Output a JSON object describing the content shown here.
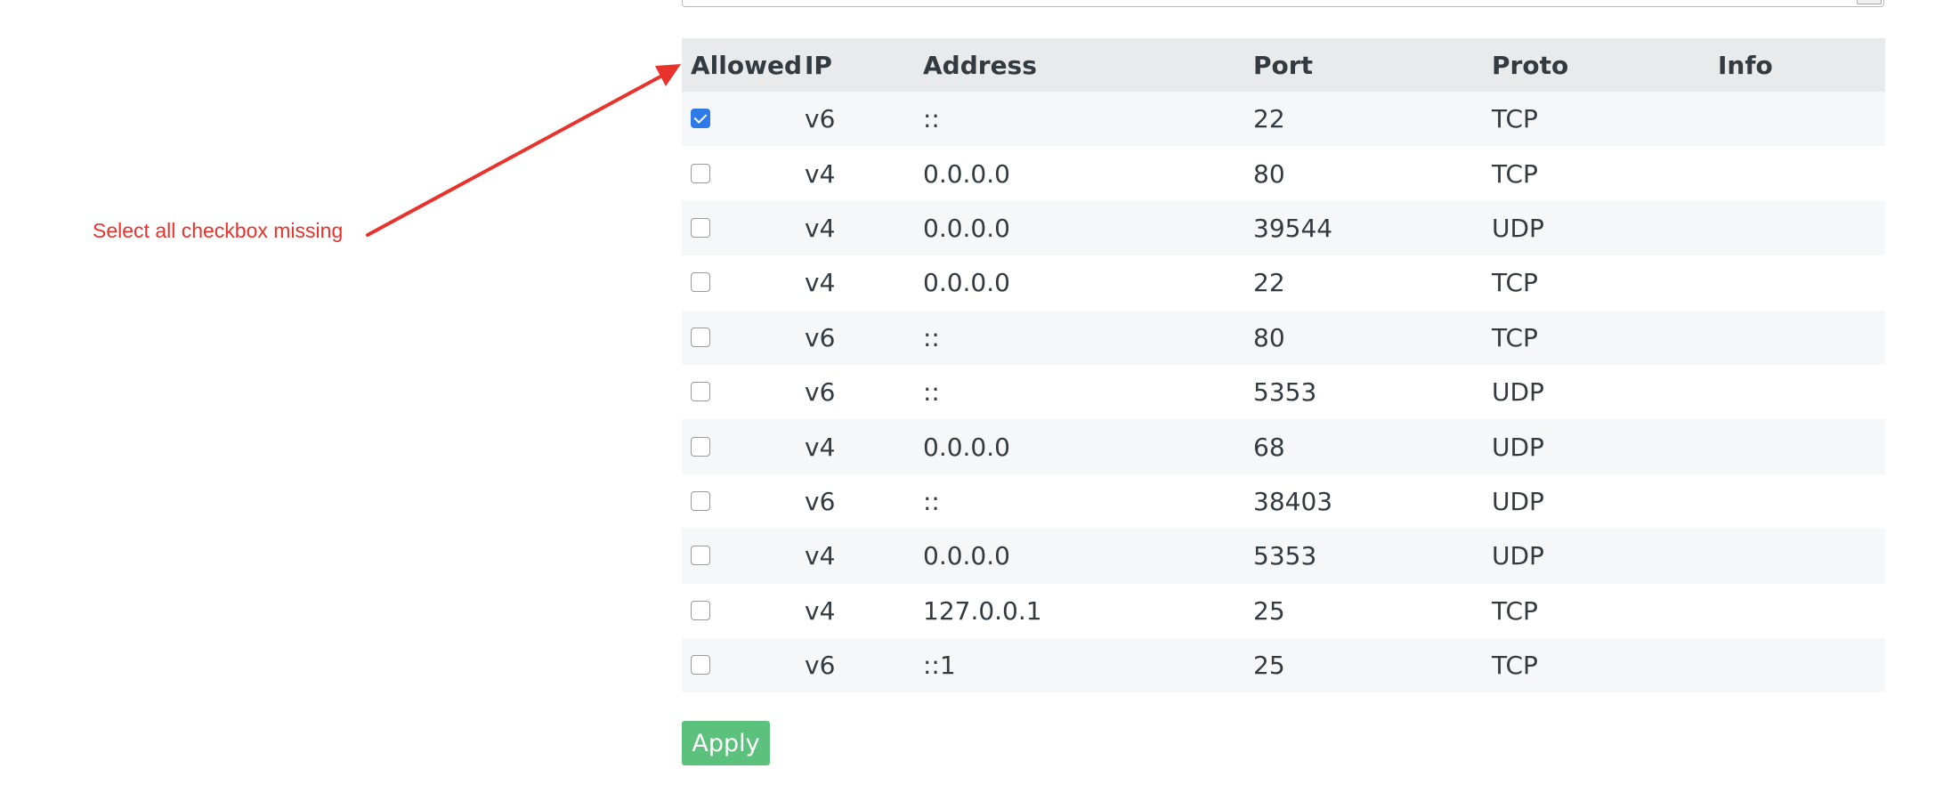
{
  "table": {
    "headers": {
      "allowed": "Allowed",
      "ip": "IP",
      "address": "Address",
      "port": "Port",
      "proto": "Proto",
      "info": "Info"
    },
    "rows": [
      {
        "allowed": true,
        "ip": "v6",
        "address": "::",
        "port": "22",
        "proto": "TCP",
        "info": ""
      },
      {
        "allowed": false,
        "ip": "v4",
        "address": "0.0.0.0",
        "port": "80",
        "proto": "TCP",
        "info": ""
      },
      {
        "allowed": false,
        "ip": "v4",
        "address": "0.0.0.0",
        "port": "39544",
        "proto": "UDP",
        "info": ""
      },
      {
        "allowed": false,
        "ip": "v4",
        "address": "0.0.0.0",
        "port": "22",
        "proto": "TCP",
        "info": ""
      },
      {
        "allowed": false,
        "ip": "v6",
        "address": "::",
        "port": "80",
        "proto": "TCP",
        "info": ""
      },
      {
        "allowed": false,
        "ip": "v6",
        "address": "::",
        "port": "5353",
        "proto": "UDP",
        "info": ""
      },
      {
        "allowed": false,
        "ip": "v4",
        "address": "0.0.0.0",
        "port": "68",
        "proto": "UDP",
        "info": ""
      },
      {
        "allowed": false,
        "ip": "v6",
        "address": "::",
        "port": "38403",
        "proto": "UDP",
        "info": ""
      },
      {
        "allowed": false,
        "ip": "v4",
        "address": "0.0.0.0",
        "port": "5353",
        "proto": "UDP",
        "info": ""
      },
      {
        "allowed": false,
        "ip": "v4",
        "address": "127.0.0.1",
        "port": "25",
        "proto": "TCP",
        "info": ""
      },
      {
        "allowed": false,
        "ip": "v6",
        "address": "::1",
        "port": "25",
        "proto": "TCP",
        "info": ""
      }
    ]
  },
  "apply_label": "Apply",
  "annotation": {
    "text": "Select all checkbox missing"
  },
  "colors": {
    "annotation": "#e8322b",
    "apply_button": "#5cc17c",
    "checkbox_checked": "#2f79e8",
    "header_bg": "#e8eaec",
    "row_stripe": "#f6f7f8"
  }
}
